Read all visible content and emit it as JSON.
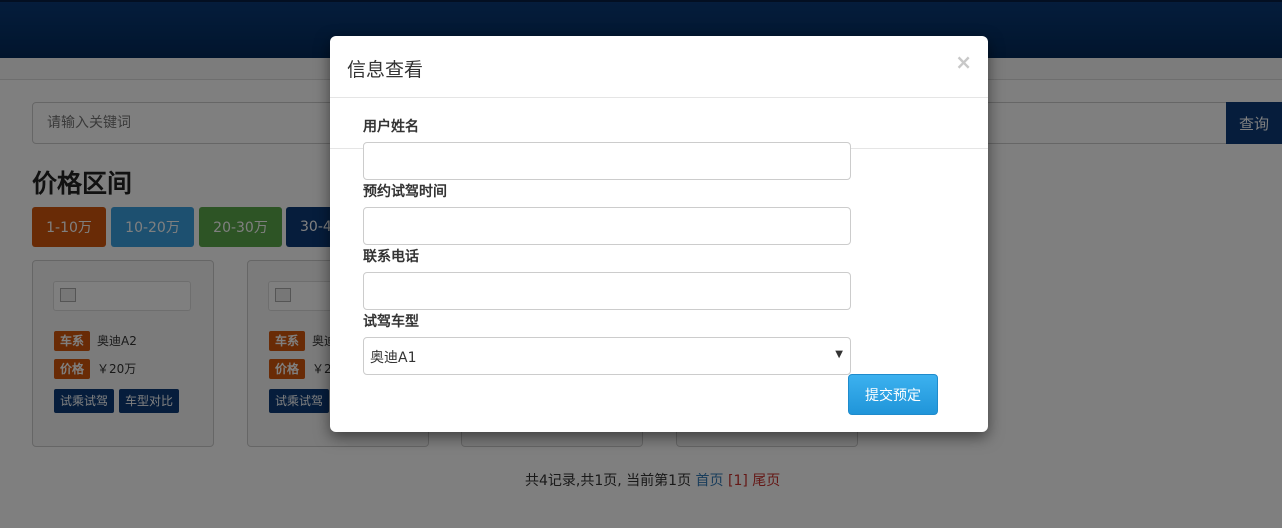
{
  "search": {
    "placeholder": "请输入关键词",
    "button_label": "查询"
  },
  "price_section": {
    "title": "价格区间",
    "ranges": [
      "1-10万",
      "10-20万",
      "20-30万",
      "30-4"
    ]
  },
  "cards": [
    {
      "series_tag": "车系",
      "series_value": "奥迪A2",
      "price_tag": "价格",
      "price_value": "￥20万",
      "test_drive_label": "试乘试驾",
      "compare_label": "车型对比"
    },
    {
      "series_tag": "车系",
      "series_value": "奥迪",
      "price_tag": "价格",
      "price_value": "￥2",
      "test_drive_label": "试乘试驾"
    }
  ],
  "pager": {
    "summary": "共4记录,共1页, 当前第1页",
    "first": "首页",
    "current": "[1]",
    "last": "尾页"
  },
  "modal": {
    "title": "信息查看",
    "close_symbol": "×",
    "fields": [
      {
        "label": "用户姓名",
        "value": ""
      },
      {
        "label": "预约试驾时间",
        "value": ""
      },
      {
        "label": "联系电话",
        "value": ""
      }
    ],
    "car_model": {
      "label": "试驾车型",
      "selected": "奥迪A1"
    },
    "submit_label": "提交预定"
  },
  "colors": {
    "topbar": "#032a5a",
    "orange": "#d3560c",
    "blue": "#3aa1e0",
    "green": "#5ba84a",
    "navy": "#0c3b78",
    "submit": "#2a9fe4"
  }
}
